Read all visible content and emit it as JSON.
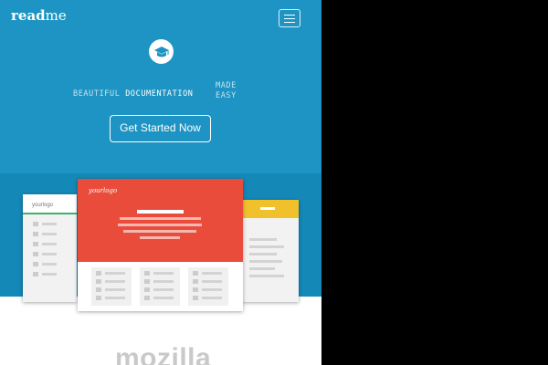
{
  "header": {
    "brand_bold": "read",
    "brand_light": "me",
    "menu_icon": "hamburger-icon"
  },
  "hero": {
    "logo_icon": "graduation-cap-icon",
    "tagline_a": "BEAUTIFUL",
    "tagline_b": "DOCUMENTATION",
    "tagline_c_1": "MADE",
    "tagline_c_2": "EASY",
    "cta_label": "Get Started Now"
  },
  "showcase": {
    "left_logo": "yourlogo",
    "main_logo": "yourlogo"
  },
  "customers": {
    "first_logo": "mozilla"
  },
  "colors": {
    "hero_bg": "#1d94c3",
    "showcase_bg": "#1488b7",
    "red": "#e94c3b",
    "yellow": "#f1c12b",
    "green": "#3cb371"
  }
}
